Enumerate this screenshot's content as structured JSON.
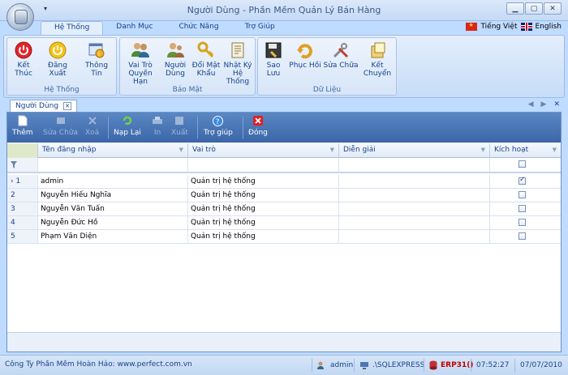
{
  "window": {
    "title": "Người Dùng - Phần Mềm Quản Lý Bán Hàng"
  },
  "ribbon_tabs": [
    "Hệ Thống",
    "Danh Mục",
    "Chức Năng",
    "Trợ Giúp"
  ],
  "language": {
    "vietnamese": "Tiếng Việt",
    "english": "English"
  },
  "groups": {
    "system": {
      "label": "Hệ Thống",
      "buttons": [
        {
          "label1": "Kết Thúc",
          "label2": ""
        },
        {
          "label1": "Đăng Xuất",
          "label2": ""
        },
        {
          "label1": "Thông Tin",
          "label2": ""
        }
      ]
    },
    "security": {
      "label": "Bảo Mật",
      "buttons": [
        {
          "label1": "Vai Trò",
          "label2": "Quyền Hạn"
        },
        {
          "label1": "Người",
          "label2": "Dùng"
        },
        {
          "label1": "Đổi Mật",
          "label2": "Khẩu"
        },
        {
          "label1": "Nhật Ký",
          "label2": "Hệ Thống"
        }
      ]
    },
    "data": {
      "label": "Dữ Liệu",
      "buttons": [
        {
          "label1": "Sao Lưu",
          "label2": ""
        },
        {
          "label1": "Phục Hồi",
          "label2": ""
        },
        {
          "label1": "Sửa Chữa",
          "label2": ""
        },
        {
          "label1": "Kết Chuyển",
          "label2": ""
        }
      ]
    }
  },
  "doc_tab": {
    "label": "Người Dùng",
    "close": "✕"
  },
  "nav_arrows": {
    "prev": "◀",
    "next": "▶",
    "close": "✕"
  },
  "toolbar": {
    "add": "Thêm",
    "edit": "Sửa Chữa",
    "delete": "Xoá",
    "reload": "Nạp Lại",
    "print": "In",
    "export": "Xuất",
    "help": "Trợ giúp",
    "close": "Đóng"
  },
  "grid": {
    "columns": [
      "Tên đăng nhập",
      "Vai trò",
      "Diễn giải",
      "Kích hoạt"
    ],
    "sort_glyph": "▼",
    "current_row_marker": "›",
    "rows": [
      {
        "num": "1",
        "username": "admin",
        "role": "Quản trị hệ thống",
        "description": "",
        "active": true
      },
      {
        "num": "2",
        "username": "Nguyễn Hiếu Nghĩa",
        "role": "Quản trị hệ thống",
        "description": "",
        "active": false
      },
      {
        "num": "3",
        "username": "Nguyễn Văn Tuấn",
        "role": "Quản trị hệ thống",
        "description": "",
        "active": false
      },
      {
        "num": "4",
        "username": "Nguyễn Đức Hồ",
        "role": "Quản trị hệ thống",
        "description": "",
        "active": false
      },
      {
        "num": "5",
        "username": "Phạm Văn Diện",
        "role": "Quản trị hệ thống",
        "description": "",
        "active": false
      }
    ]
  },
  "status": {
    "company": "Công Ty Phần Mềm Hoàn Hảo:  www.perfect.com.vn",
    "user": "admin",
    "server": ".\\SQLEXPRESS",
    "database": "ERP31()",
    "time": "07:52:27",
    "date": "07/07/2010"
  },
  "colors": {
    "accent": "#15428b",
    "toolbar": "#4a76b8",
    "erp": "#c00000"
  }
}
